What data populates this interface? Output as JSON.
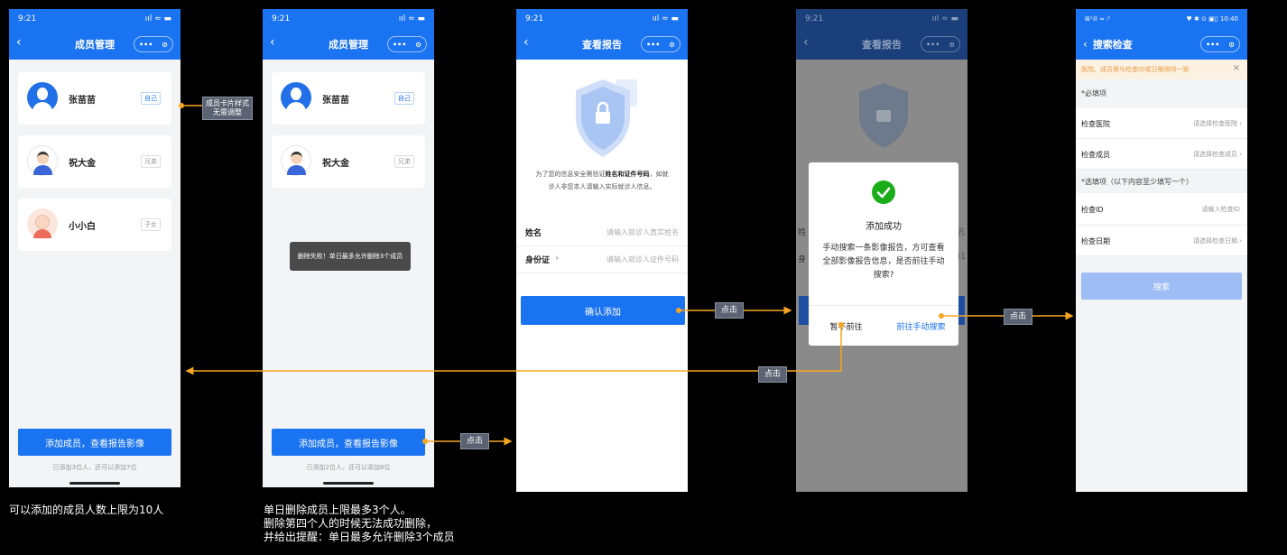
{
  "status_time": "9:21",
  "status_right": "ııl ≈ ▬",
  "capsule": {
    "dots": "•••",
    "target": "⊙"
  },
  "screen1": {
    "title": "成员管理",
    "members": [
      {
        "name": "张苗苗",
        "tag": "自己"
      },
      {
        "name": "祝大金",
        "tag": "兄弟"
      },
      {
        "name": "小小白",
        "tag": "子女"
      }
    ],
    "button": "添加成员，查看报告影像",
    "footer": "已添加3位人，还可以添加7位"
  },
  "screen2": {
    "title": "成员管理",
    "members": [
      {
        "name": "张苗苗",
        "tag": "自己"
      },
      {
        "name": "祝大金",
        "tag": "兄弟"
      }
    ],
    "toast": "删除失败！单日最多允许删除3个成员",
    "button": "添加成员，查看报告影像",
    "footer": "已添加2位人，还可以添加8位"
  },
  "screen3": {
    "title": "查看报告",
    "desc_line1_a": "为了您的信息安全需验证",
    "desc_line1_b": "姓名和证件号码",
    "desc_line1_c": "，如就",
    "desc_line2": "诊人非您本人请输入实际就诊人信息。",
    "name_label": "姓名",
    "name_placeholder": "请输入就诊人真实姓名",
    "id_label": "身份证",
    "id_arrow": "›",
    "id_placeholder": "请输入就诊人证件号码",
    "button": "确认添加"
  },
  "screen4": {
    "time": "9:21",
    "title": "查看报告",
    "dialog_title": "添加成功",
    "dialog_body": "手动搜索一条影像报告，方可查看全部影像报告信息，是否前往手动搜索?",
    "cancel": "暂不前往",
    "confirm": "前往手动搜索",
    "behind_left1": "姓",
    "behind_left2": "身",
    "behind_right1": "孔",
    "behind_right2": "31"
  },
  "screen5": {
    "status_left": "⊞¹ᵢll ≈ ᵢ¹",
    "status_right": "♥ ✱ ⊙ ▣▯ 10:40",
    "title": "搜索检查",
    "banner": "医院、成员需与检查ID或日期保持一致",
    "banner_close": "×",
    "required_header": "*必填项",
    "hospital_label": "检查医院",
    "hospital_value": "请选择检查医院 ›",
    "member_label": "检查成员",
    "member_value": "请选择检查成员 ›",
    "optional_header": "*选填项（以下内容至少填写一个）",
    "checkid_label": "检查ID",
    "checkid_value": "请输入检查ID",
    "date_label": "检查日期",
    "date_value": "请选择检查日期 ›",
    "search_button": "搜索"
  },
  "annotations": {
    "card_style": "成员卡片样式\n无需调整",
    "click": "点击",
    "note1": "可以添加的成员人数上限为10人",
    "note2": [
      "单日删除成员上限最多3个人。",
      "删除第四个人的时候无法成功删除，",
      "并给出提醒：单日最多允许删除3个成员"
    ]
  },
  "colors": {
    "primary": "#1a73f0",
    "arrow": "#f5a623",
    "success": "#1aad19",
    "banner": "#fdf1e1"
  }
}
